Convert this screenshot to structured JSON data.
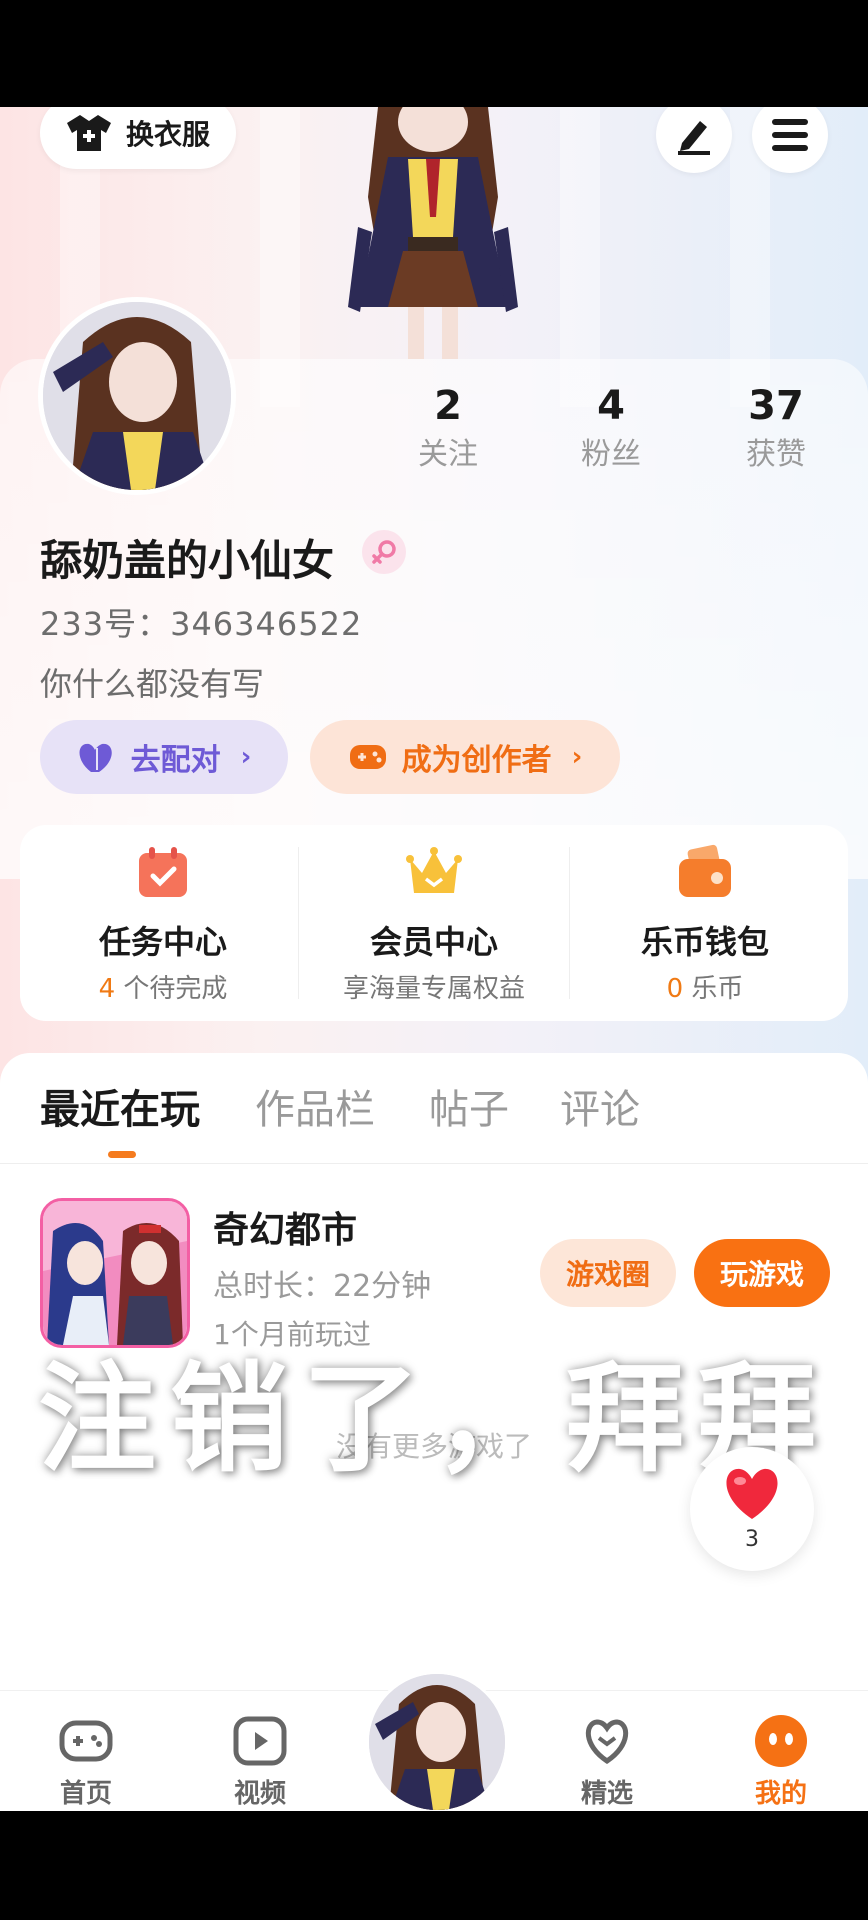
{
  "header": {
    "change_clothes_label": "换衣服",
    "edit_icon": "pen-icon",
    "menu_icon": "hamburger-menu-icon"
  },
  "profile": {
    "stats": [
      {
        "value": "2",
        "label": "关注"
      },
      {
        "value": "4",
        "label": "粉丝"
      },
      {
        "value": "37",
        "label": "获赞"
      }
    ],
    "username": "舔奶盖的小仙女",
    "gender_icon": "female-icon",
    "id_label": "233号：346346522",
    "bio": "你什么都没有写",
    "pair_button": "去配对",
    "creator_button": "成为创作者"
  },
  "services": [
    {
      "title": "任务中心",
      "highlight": "4",
      "subtitle": " 个待完成",
      "icon": "calendar-check-icon"
    },
    {
      "title": "会员中心",
      "highlight": "",
      "subtitle": "享海量专属权益",
      "icon": "crown-icon"
    },
    {
      "title": "乐币钱包",
      "highlight": "0",
      "subtitle": " 乐币",
      "icon": "wallet-icon"
    }
  ],
  "tabs": [
    "最近在玩",
    "作品栏",
    "帖子",
    "评论"
  ],
  "recent_game": {
    "name": "奇幻都市",
    "total_time": "总时长：22分钟",
    "last_played": "1个月前玩过",
    "circle_button": "游戏圈",
    "play_button": "玩游戏"
  },
  "no_more_text": "没有更多游戏了",
  "overlay_text": "注销了，拜拜",
  "like": {
    "count": "3",
    "icon": "heart-icon"
  },
  "bottom_nav": [
    "首页",
    "视频",
    "精选",
    "我的"
  ],
  "colors": {
    "accent_orange": "#f57114",
    "purple": "#6e5ad6",
    "pink": "#f35fa4"
  }
}
